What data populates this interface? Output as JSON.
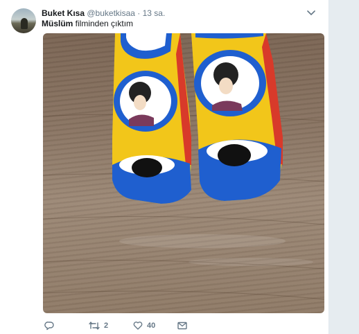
{
  "tweet": {
    "author_name": "Buket Kısa",
    "author_handle": "@buketkisaa",
    "separator": "·",
    "time": "13 sa.",
    "text_bold": "Müslüm",
    "text_rest": " filminden çıktım"
  },
  "actions": {
    "reply_count": "",
    "retweet_count": "2",
    "like_count": "40"
  },
  "colors": {
    "icon_gray": "#657786",
    "name_black": "#14171a",
    "sock_yellow": "#f2c61a",
    "sock_blue": "#1f5fcf",
    "sock_red": "#d83a2a"
  },
  "icons": [
    "chevron-down-icon",
    "reply-icon",
    "retweet-icon",
    "heart-icon",
    "envelope-icon"
  ]
}
